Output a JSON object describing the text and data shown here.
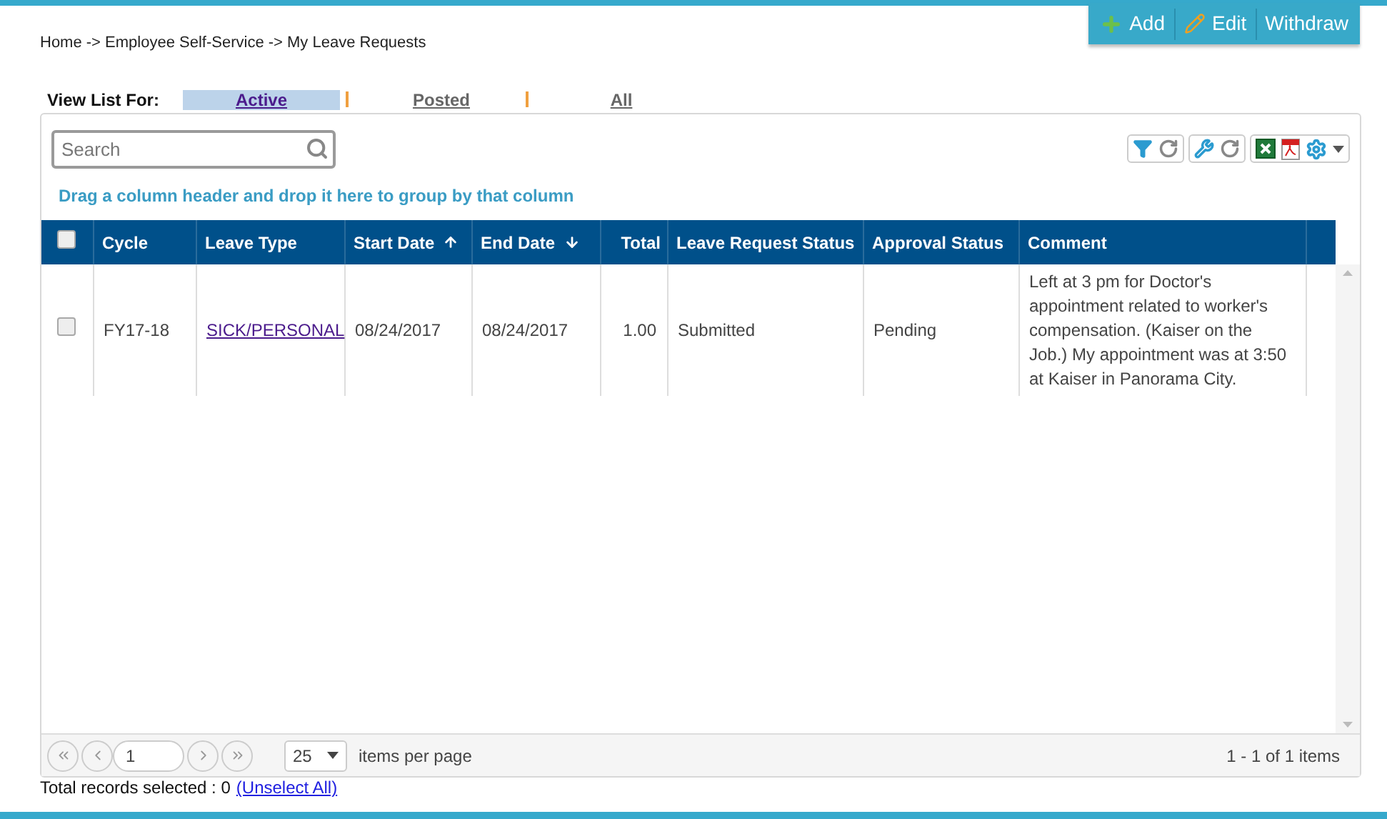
{
  "breadcrumb": "Home -> Employee Self-Service -> My Leave Requests",
  "actions": [
    {
      "label": "Add",
      "kind": "add"
    },
    {
      "label": "Edit",
      "kind": "edit"
    },
    {
      "label": "Withdraw",
      "kind": "plain"
    }
  ],
  "view_list": {
    "label": "View List For:",
    "tabs": [
      {
        "label": "Active",
        "selected": true
      },
      {
        "label": "Posted",
        "selected": false
      },
      {
        "label": "All",
        "selected": false
      }
    ]
  },
  "search": {
    "placeholder": "Search"
  },
  "group_hint": "Drag a column header and drop it here to group by that column",
  "table": {
    "select_all_checked": false,
    "columns": [
      {
        "label": "Cycle",
        "sort_ascending": false,
        "sort_descending": false,
        "numeric": false
      },
      {
        "label": "Leave Type",
        "sort_ascending": false,
        "sort_descending": false,
        "numeric": false
      },
      {
        "label": "Start Date",
        "sort_ascending": true,
        "sort_descending": false,
        "numeric": false
      },
      {
        "label": "End Date",
        "sort_ascending": false,
        "sort_descending": true,
        "numeric": false
      },
      {
        "label": "Total",
        "sort_ascending": false,
        "sort_descending": false,
        "numeric": true
      },
      {
        "label": "Leave Request Status",
        "sort_ascending": false,
        "sort_descending": false,
        "numeric": false
      },
      {
        "label": "Approval Status",
        "sort_ascending": false,
        "sort_descending": false,
        "numeric": false
      },
      {
        "label": "Comment",
        "sort_ascending": false,
        "sort_descending": false,
        "numeric": false
      }
    ],
    "rows": [
      {
        "checked": false,
        "cells": [
          "FY17-18",
          "SICK/PERSONAL",
          "08/24/2017",
          "08/24/2017",
          "1.00",
          "Submitted",
          "Pending",
          "Left at 3 pm for Doctor's appointment related to worker's compensation. (Kaiser on the Job.) My appointment was at 3:50 at Kaiser in Panorama City."
        ]
      }
    ]
  },
  "pager": {
    "page": "1",
    "page_size": "25",
    "page_size_label": "items per page",
    "summary": "1 - 1 of 1 items"
  },
  "footer": {
    "text": "Total records selected : 0",
    "link": "(Unselect All)"
  }
}
